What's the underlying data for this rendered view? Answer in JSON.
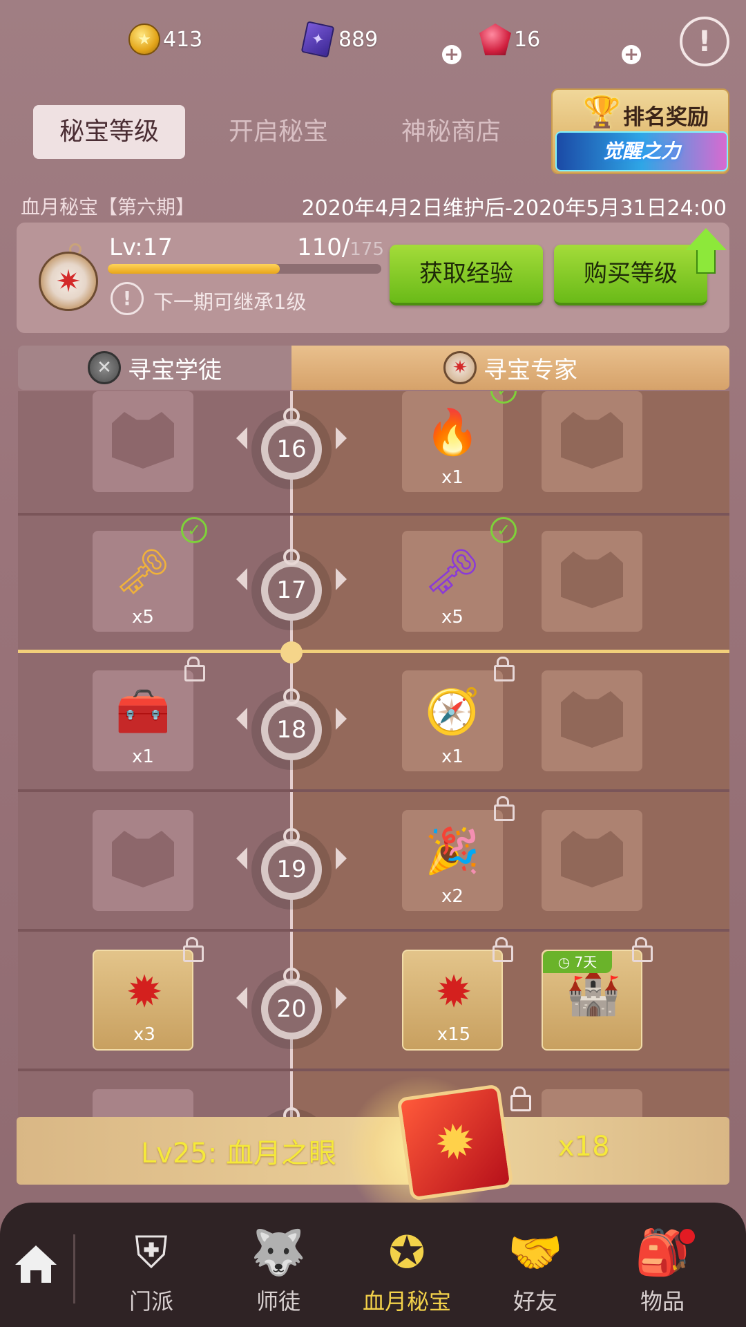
{
  "currency": {
    "coins": "413",
    "cards": "889",
    "gems": "16"
  },
  "tabs": [
    {
      "label": "秘宝等级",
      "active": true
    },
    {
      "label": "开启秘宝",
      "active": false
    },
    {
      "label": "神秘商店",
      "active": false
    }
  ],
  "rank_badge": {
    "title": "排名奖励",
    "banner": "觉醒之力"
  },
  "season": {
    "name": "血月秘宝【第六期】",
    "date_range": "2020年4月2日维护后-2020年5月31日24:00"
  },
  "level_panel": {
    "level_text": "Lv:17",
    "xp_current": "110/",
    "xp_max": "175",
    "xp_progress": 0.629,
    "inherit_text": "下一期可继承1级",
    "btn_get_exp": "获取经验",
    "btn_buy_level": "购买等级"
  },
  "tracks": {
    "left_label": "寻宝学徒",
    "right_label": "寻宝专家"
  },
  "rows": [
    {
      "level": "16",
      "left_qty": "",
      "right1_qty": "x1",
      "right2_qty": ""
    },
    {
      "level": "17",
      "left_qty": "x5",
      "right1_qty": "x5",
      "right2_qty": ""
    },
    {
      "level": "18",
      "left_qty": "x1",
      "right1_qty": "x1",
      "right2_qty": ""
    },
    {
      "level": "19",
      "left_qty": "",
      "right1_qty": "x2",
      "right2_qty": ""
    },
    {
      "level": "20",
      "left_qty": "x3",
      "right1_qty": "x15",
      "right2_qty": "",
      "right2_timer": "7天"
    }
  ],
  "reward_banner": {
    "title": "Lv25: 血月之眼",
    "qty": "x18"
  },
  "nav": [
    {
      "label": "门派",
      "icon": "shield-icon",
      "active": false
    },
    {
      "label": "师徒",
      "icon": "wolf-icon",
      "active": false
    },
    {
      "label": "血月秘宝",
      "icon": "compass-icon",
      "active": true
    },
    {
      "label": "好友",
      "icon": "handshake-icon",
      "active": false
    },
    {
      "label": "物品",
      "icon": "backpack-icon",
      "active": false
    }
  ]
}
